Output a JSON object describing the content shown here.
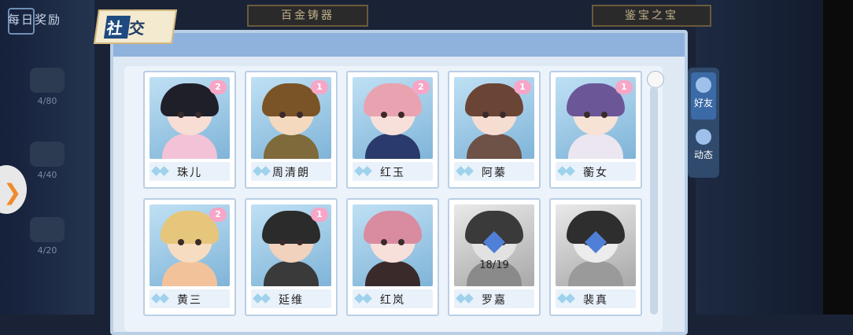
{
  "header": {
    "daily_reward": "每日奖励",
    "tab_left": "百金铸器",
    "tab_right": "鉴宝之宝",
    "title": "社交"
  },
  "side_rewards": [
    "4/80",
    "4/40",
    "4/20"
  ],
  "sidebar": {
    "tabs": [
      {
        "label": "好友",
        "icon": "friends-icon",
        "active": true
      },
      {
        "label": "动态",
        "icon": "moments-icon",
        "active": false
      }
    ]
  },
  "friends": [
    {
      "name": "珠儿",
      "hearts": "2",
      "locked": false,
      "hair": "#1f1f2a",
      "skin": "#f7ddd3",
      "body": "#f2c2d6"
    },
    {
      "name": "周清朗",
      "hearts": "1",
      "locked": false,
      "hair": "#7a5427",
      "skin": "#f4d9bf",
      "body": "#7e6a3a"
    },
    {
      "name": "红玉",
      "hearts": "2",
      "locked": false,
      "hair": "#e9a3b0",
      "skin": "#f8e0da",
      "body": "#2a3a6c"
    },
    {
      "name": "阿蓁",
      "hearts": "1",
      "locked": false,
      "hair": "#6a4434",
      "skin": "#f6ddd2",
      "body": "#6e5147"
    },
    {
      "name": "蘅女",
      "hearts": "1",
      "locked": false,
      "hair": "#6b5698",
      "skin": "#f7e2d6",
      "body": "#ebe6f0"
    },
    {
      "name": "黄三",
      "hearts": "2",
      "locked": false,
      "hair": "#e6c67a",
      "skin": "#f6dcc0",
      "body": "#f2c39a"
    },
    {
      "name": "延维",
      "hearts": "1",
      "locked": false,
      "hair": "#2b2b2b",
      "skin": "#f1d2bd",
      "body": "#3a3a3a"
    },
    {
      "name": "红岚",
      "hearts": "",
      "locked": false,
      "hair": "#d98ca0",
      "skin": "#f8e0da",
      "body": "#3a2a2a"
    },
    {
      "name": "罗嘉",
      "hearts": "",
      "locked": true,
      "count": "18/19",
      "hair": "#3a3a3a",
      "skin": "#e2e2e2",
      "body": "#8a8a8a"
    },
    {
      "name": "裴真",
      "hearts": "",
      "locked": true,
      "count": "",
      "hair": "#2e2e2e",
      "skin": "#ececec",
      "body": "#9a9a9a"
    }
  ]
}
